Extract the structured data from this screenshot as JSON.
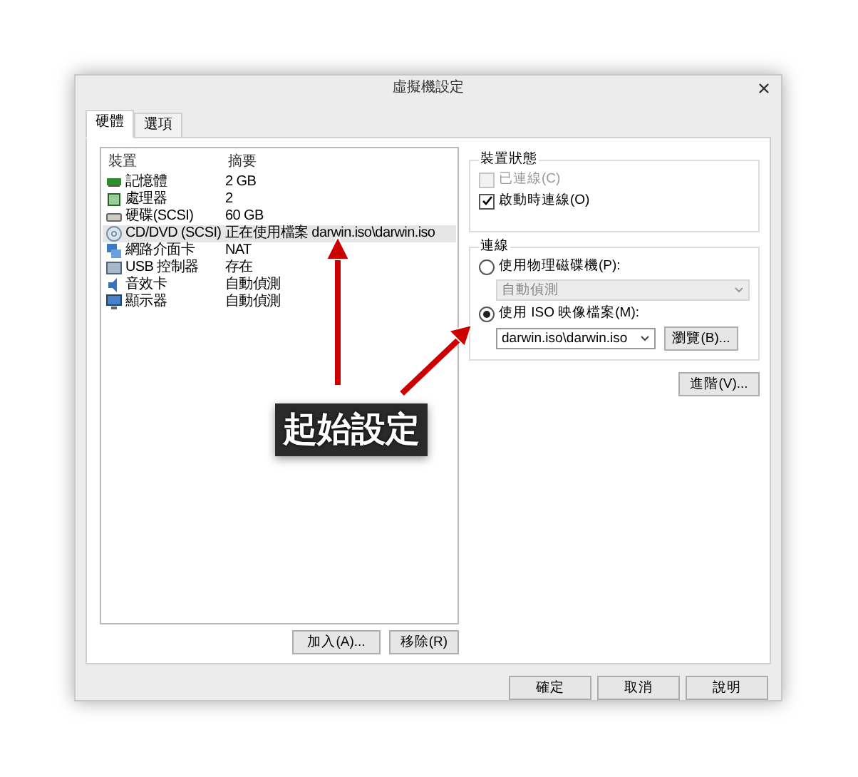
{
  "window": {
    "title": "虛擬機設定"
  },
  "tabs": [
    {
      "label": "硬體",
      "selected": true
    },
    {
      "label": "選項",
      "selected": false
    }
  ],
  "devices": {
    "columns": [
      "裝置",
      "摘要"
    ],
    "rows": [
      {
        "kind": "memory",
        "name": "記憶體",
        "summary": "2 GB",
        "selected": false
      },
      {
        "kind": "cpu",
        "name": "處理器",
        "summary": "2",
        "selected": false
      },
      {
        "kind": "disk",
        "name": "硬碟(SCSI)",
        "summary": "60 GB",
        "selected": false
      },
      {
        "kind": "cd",
        "name": "CD/DVD (SCSI)",
        "summary": "正在使用檔案 darwin.iso\\darwin.iso",
        "selected": true
      },
      {
        "kind": "network",
        "name": "網路介面卡",
        "summary": "NAT",
        "selected": false
      },
      {
        "kind": "usb",
        "name": "USB 控制器",
        "summary": "存在",
        "selected": false
      },
      {
        "kind": "sound",
        "name": "音效卡",
        "summary": "自動偵測",
        "selected": false
      },
      {
        "kind": "display",
        "name": "顯示器",
        "summary": "自動偵測",
        "selected": false
      }
    ]
  },
  "list_buttons": [
    "加入(A)...",
    "移除(R)"
  ],
  "device_status": {
    "title": "裝置狀態",
    "options": [
      {
        "label": "已連線(C)",
        "checked": false,
        "disabled": true
      },
      {
        "label": "啟動時連線(O)",
        "checked": true,
        "disabled": false
      }
    ]
  },
  "connection": {
    "title": "連線",
    "options": [
      {
        "kind": "drive",
        "label": "使用物理磁碟機(P):",
        "selected": false,
        "value": "自動偵測"
      },
      {
        "kind": "iso",
        "label": "使用 ISO 映像檔案(M):",
        "selected": true,
        "value": "darwin.iso\\darwin.iso",
        "browse": "瀏覽(B)..."
      }
    ]
  },
  "advanced_button": "進階(V)...",
  "dialog_buttons": [
    "確定",
    "取消",
    "說明"
  ],
  "annotation": {
    "label": "起始設定"
  }
}
